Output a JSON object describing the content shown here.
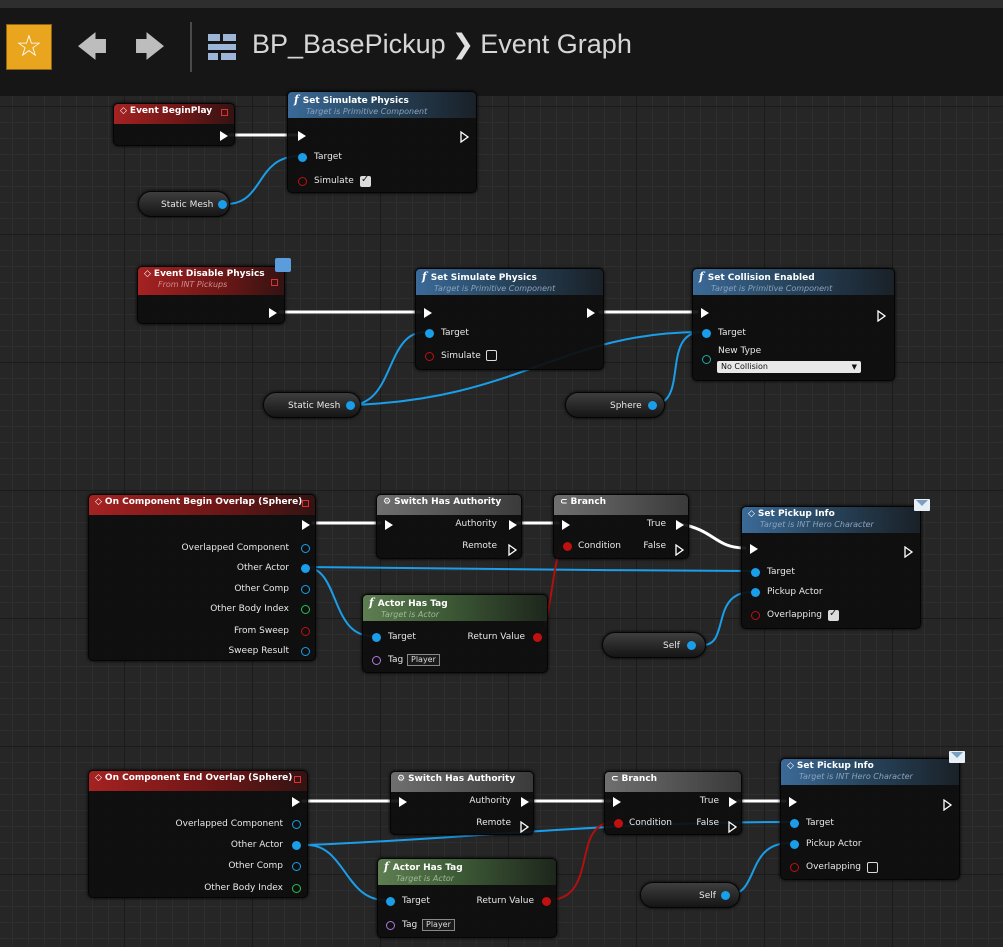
{
  "toolbar": {
    "favorite_icon": "star-icon",
    "back_icon": "back-arrow-icon",
    "forward_icon": "forward-arrow-icon",
    "graph_icon": "event-graph-icon",
    "blueprint_name": "BP_BasePickup",
    "separator": "❯",
    "graph_name": "Event Graph"
  },
  "colors": {
    "accent_star": "#e8a51d",
    "exec_wire": "#ffffff",
    "object_pin": "#1a9eea",
    "bool_pin": "#c01010",
    "function_header": "#3b6a98",
    "pure_header": "#5e7e52",
    "event_header": "#a52222"
  },
  "nodes": {
    "event_begin_play": {
      "title": "Event BeginPlay"
    },
    "set_sim_1": {
      "title": "Set Simulate Physics",
      "subtitle": "Target is Primitive Component",
      "target": "Target",
      "simulate": "Simulate",
      "simulate_checked": true
    },
    "static_mesh_1": {
      "label": "Static Mesh"
    },
    "event_disable_physics": {
      "title": "Event Disable Physics",
      "subtitle": "From INT Pickups"
    },
    "set_sim_2": {
      "title": "Set Simulate Physics",
      "subtitle": "Target is Primitive Component",
      "target": "Target",
      "simulate": "Simulate",
      "simulate_checked": false
    },
    "set_collision": {
      "title": "Set Collision Enabled",
      "subtitle": "Target is Primitive Component",
      "target": "Target",
      "new_type": "New Type",
      "new_type_value": "No Collision"
    },
    "static_mesh_2": {
      "label": "Static Mesh"
    },
    "sphere": {
      "label": "Sphere"
    },
    "begin_overlap": {
      "title": "On Component Begin Overlap (Sphere)",
      "pins": [
        "Overlapped Component",
        "Other Actor",
        "Other Comp",
        "Other Body Index",
        "From Sweep",
        "Sweep Result"
      ]
    },
    "switch_auth_1": {
      "title": "Switch Has Authority",
      "authority": "Authority",
      "remote": "Remote"
    },
    "branch_1": {
      "title": "Branch",
      "condition": "Condition",
      "true": "True",
      "false": "False"
    },
    "set_pickup_1": {
      "title": "Set Pickup Info",
      "subtitle": "Target is INT Hero Character",
      "target": "Target",
      "pickup_actor": "Pickup Actor",
      "overlapping": "Overlapping",
      "overlapping_checked": true
    },
    "actor_has_tag_1": {
      "title": "Actor Has Tag",
      "subtitle": "Target is Actor",
      "target": "Target",
      "return_value": "Return Value",
      "tag": "Tag",
      "tag_value": "Player"
    },
    "self_1": {
      "label": "Self"
    },
    "end_overlap": {
      "title": "On Component End Overlap (Sphere)",
      "pins": [
        "Overlapped Component",
        "Other Actor",
        "Other Comp",
        "Other Body Index"
      ]
    },
    "switch_auth_2": {
      "title": "Switch Has Authority",
      "authority": "Authority",
      "remote": "Remote"
    },
    "branch_2": {
      "title": "Branch",
      "condition": "Condition",
      "true": "True",
      "false": "False"
    },
    "set_pickup_2": {
      "title": "Set Pickup Info",
      "subtitle": "Target is INT Hero Character",
      "target": "Target",
      "pickup_actor": "Pickup Actor",
      "overlapping": "Overlapping",
      "overlapping_checked": false
    },
    "actor_has_tag_2": {
      "title": "Actor Has Tag",
      "subtitle": "Target is Actor",
      "target": "Target",
      "return_value": "Return Value",
      "tag": "Tag",
      "tag_value": "Player"
    },
    "self_2": {
      "label": "Self"
    }
  }
}
